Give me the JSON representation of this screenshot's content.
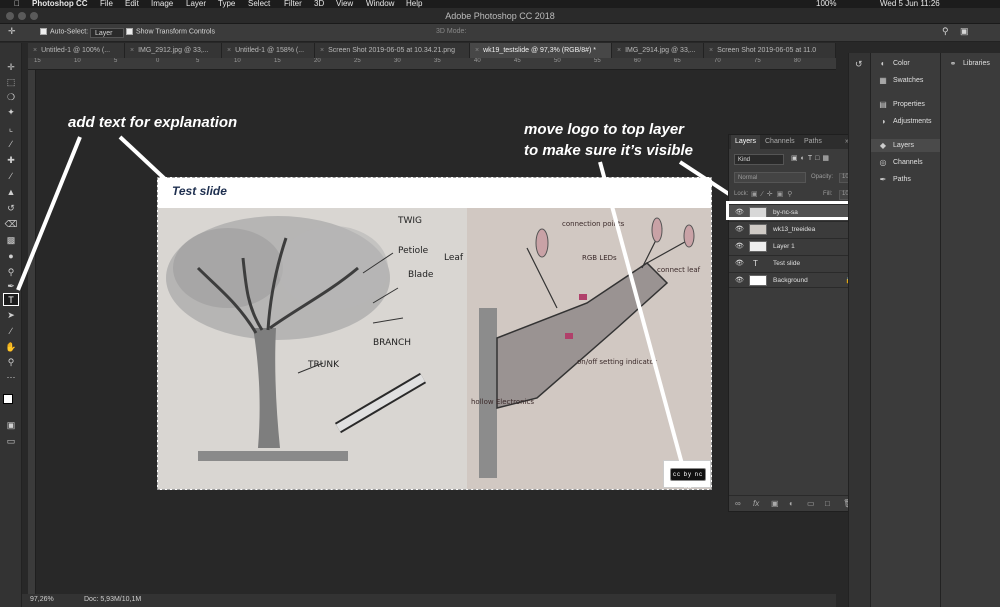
{
  "menubar": {
    "app": "Photoshop CC",
    "items": [
      "File",
      "Edit",
      "Image",
      "Layer",
      "Type",
      "Select",
      "Filter",
      "3D",
      "View",
      "Window",
      "Help"
    ],
    "battery": "100%",
    "clock": "Wed 5 Jun  11:26"
  },
  "window": {
    "title": "Adobe Photoshop CC 2018"
  },
  "options": {
    "auto_select_label": "Auto-Select:",
    "auto_select_value": "Layer",
    "transform_label": "Show Transform Controls",
    "mode3d": "3D Mode:"
  },
  "tabs": [
    "Untitled-1 @ 100% (...",
    "IMG_2912.jpg @ 33,...",
    "Untitled-1 @ 158% (...",
    "Screen Shot 2019-06-05 at 10.34.21.png",
    "wk19_testslide @ 97,3% (RGB/8#) *",
    "IMG_2914.jpg @ 33,...",
    "Screen Shot 2019-06-05 at 11.0"
  ],
  "ruler": {
    "ticks": [
      "15",
      "10",
      "5",
      "0",
      "5",
      "10",
      "15",
      "20",
      "25",
      "30",
      "35",
      "40",
      "45",
      "50",
      "55",
      "60",
      "65",
      "70",
      "75",
      "80"
    ]
  },
  "status": {
    "zoom": "97,26%",
    "doc": "Doc: 5,93M/10,1M"
  },
  "slide": {
    "title": "Test slide",
    "left_labels": [
      "TWIG",
      "Petiole",
      "Blade",
      "Leaf",
      "BRANCH",
      "TRUNK"
    ],
    "right_labels": [
      "connection points",
      "RGB LEDs",
      "connect leaf",
      "on/off setting indicator",
      "hollow Electronics"
    ],
    "logo_text": "cc by nc sa"
  },
  "annotations": {
    "left": "add text for explanation",
    "right_line1": "move logo to top layer",
    "right_line2": "to make sure it’s visible"
  },
  "layers_panel": {
    "tabs": [
      "Layers",
      "Channels",
      "Paths"
    ],
    "kind": "Kind",
    "blend": "Normal",
    "opacity_label": "Opacity:",
    "opacity_value": "100%",
    "lock_label": "Lock:",
    "fill_label": "Fill:",
    "fill_value": "100%",
    "layers": [
      {
        "name": "by-nc-sa"
      },
      {
        "name": "wk13_treeidea"
      },
      {
        "name": "Layer 1"
      },
      {
        "name": "Test slide",
        "type": "text"
      },
      {
        "name": "Background",
        "locked": true
      }
    ]
  },
  "dock": {
    "group1": [
      "Color",
      "Swatches"
    ],
    "group2": [
      "Properties",
      "Adjustments"
    ],
    "group3": [
      "Layers",
      "Channels",
      "Paths"
    ],
    "libraries": "Libraries"
  },
  "colors": {
    "accent": "#ffffff",
    "panel": "#3b3b3b",
    "canvas_bg": "#282828",
    "slide_title": "#1e2f4f"
  }
}
